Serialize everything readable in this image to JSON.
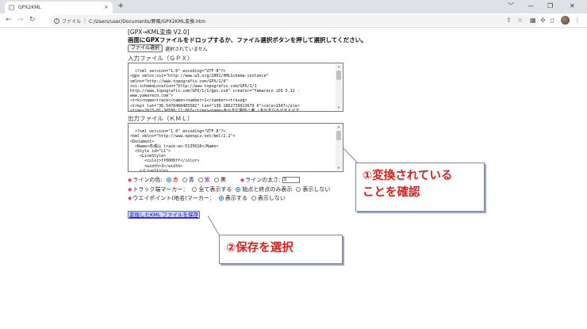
{
  "browser": {
    "tab_title": "GPX2KML",
    "tab_close": "×",
    "new_tab": "+",
    "window_controls": [
      "﹀",
      "—",
      "❐",
      "✕"
    ],
    "nav": {
      "back": "←",
      "forward": "→",
      "reload": "↻"
    },
    "address": {
      "info_icon": "i",
      "scheme_label": "ファイル",
      "url": "C:/Users/user/Documents/野風/GPX2KML変換.htm"
    }
  },
  "page": {
    "heading": "[GPX→KML変換 V2.0]",
    "instruction": "画面にGPXファイルをドロップするか、ファイル選択ボタンを押して選択してください。",
    "file_button": "ファイル選択",
    "file_status": "選択されていません",
    "input_label": "入力ファイル（ＧＰＸ）",
    "input_text": "<?xml version=\"1.0\" encoding=\"UTF-8\"?>\n<gpx xmlns:xsi=\"http://www.w3.org/2001/XMLSchema-instance\"\nxmlns=\"http://www.topografix.com/GPX/1/0\"\nxsi:schemaLocation=\"http://www.topografix.com/GPX/1/1\nhttp://www.topografix.com/GPX/1/1/gpx.xsd\" creator=\"Yamareco iOS 5.12 -\nwww.yamareco.com\">\n<trk><name>track</name><number>1</number><trkseg>\n<trkpt lat=\"36.5478460405582\" lon=\"139.1862739913679 6\"><ele>1347</ele>\n<time>2023-01-30T00:11:06Z</time><name>あかぎ広場前八弗 (あかぎひろばまえばす\nてい)</name><type>12</type>",
    "output_label": "出力ファイル（ＫＭＬ）",
    "output_text": "<?xml version=\"1.0\" encoding=\"UTF-8\"?>\n<kml xmlns=\"http://www.opengis.net/kml/2.2\">\n<Document>\n  <Name>赤城山 track-en-5135618</Name>\n  <Style id=\"L1\">\n    <LineStyle>\n      <color>ff0000ff</color>\n      <width>3</width>\n    </LineStyle>\n  </Style>",
    "line_color": {
      "label": "ラインの色:",
      "options": [
        "赤",
        "青",
        "紫",
        "黒"
      ],
      "selected": "赤"
    },
    "line_width": {
      "label": "ラインの太さ:",
      "value": "3"
    },
    "track_marker": {
      "label": "トラック端マーカー：",
      "options": [
        "全て表示する",
        "始点と終点のみ表示",
        "表示しない"
      ],
      "selected": "始点と終点のみ表示"
    },
    "waypoint_marker": {
      "label": "ウエイポイント(地名)マーカー：",
      "options": [
        "表示する",
        "表示しない"
      ],
      "selected": "表示する"
    },
    "save_link": "変換したKML ファイルを保存",
    "bullet": "◆"
  },
  "callouts": {
    "confirm": [
      "①変換されている",
      "ことを確認"
    ],
    "save": "②保存を選択"
  },
  "colors": {
    "callout_text": "#e0201c",
    "callout_border": "#7a8aa6",
    "bullet": "#e8417a",
    "link": "#1a0dab"
  }
}
